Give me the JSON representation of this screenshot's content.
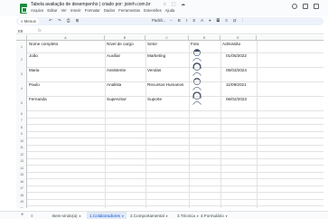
{
  "app": {
    "title": "Tabela avaliação de desempenho | criado por: joinrh.com.br",
    "title_icons": "☆ ⬚ ☁",
    "menu": [
      "Arquivo",
      "Editar",
      "Ver",
      "Inserir",
      "Formatar",
      "Dados",
      "Ferramentas",
      "Extensões",
      "Ajuda"
    ]
  },
  "toolbar": {
    "search_label": "Menus",
    "icons_left": "↶ ↷ ⎙ ⊞",
    "zoom": "Padrã...",
    "icons_right": "− B I S A ⌖ ▦ ≡ ⇵ ⋮"
  },
  "formula": {
    "namebox": "E8",
    "fx": "fx"
  },
  "columns": [
    "A",
    "B",
    "C",
    "D",
    "E"
  ],
  "rows": [
    "1",
    "2",
    "3",
    "4",
    "5",
    "6",
    "7",
    "8",
    "9",
    "10",
    "11",
    "12",
    "13",
    "14",
    "15",
    "16",
    "17",
    "18",
    "19",
    "20",
    "21",
    "22"
  ],
  "table": {
    "headers": [
      "Nome completo",
      "Nível de cargo",
      "Setor",
      "Foto",
      "Admissão"
    ],
    "data": [
      [
        "João",
        "Auxiliar",
        "Marketing",
        "",
        "01/05/2022"
      ],
      [
        "Maria",
        "Assistente",
        "Vendas",
        "",
        "05/03/2024"
      ],
      [
        "Paulo",
        "Analista",
        "Recursos Humanos",
        "",
        "11/09/2021"
      ],
      [
        "Fernanda",
        "Supervisor",
        "Suporte",
        "",
        "06/02/2023"
      ]
    ]
  },
  "tabs": [
    {
      "label": "Bem-vindo(a)",
      "active": false
    },
    {
      "label": "1.Colaboradores",
      "active": true
    },
    {
      "label": "2.Comportamental",
      "active": false
    },
    {
      "label": "3.Técnica",
      "active": false
    },
    {
      "label": "4.Formulário",
      "active": false
    }
  ],
  "colors": {
    "accent": "#0b57d0",
    "sheets_green": "#1e8e3e"
  }
}
